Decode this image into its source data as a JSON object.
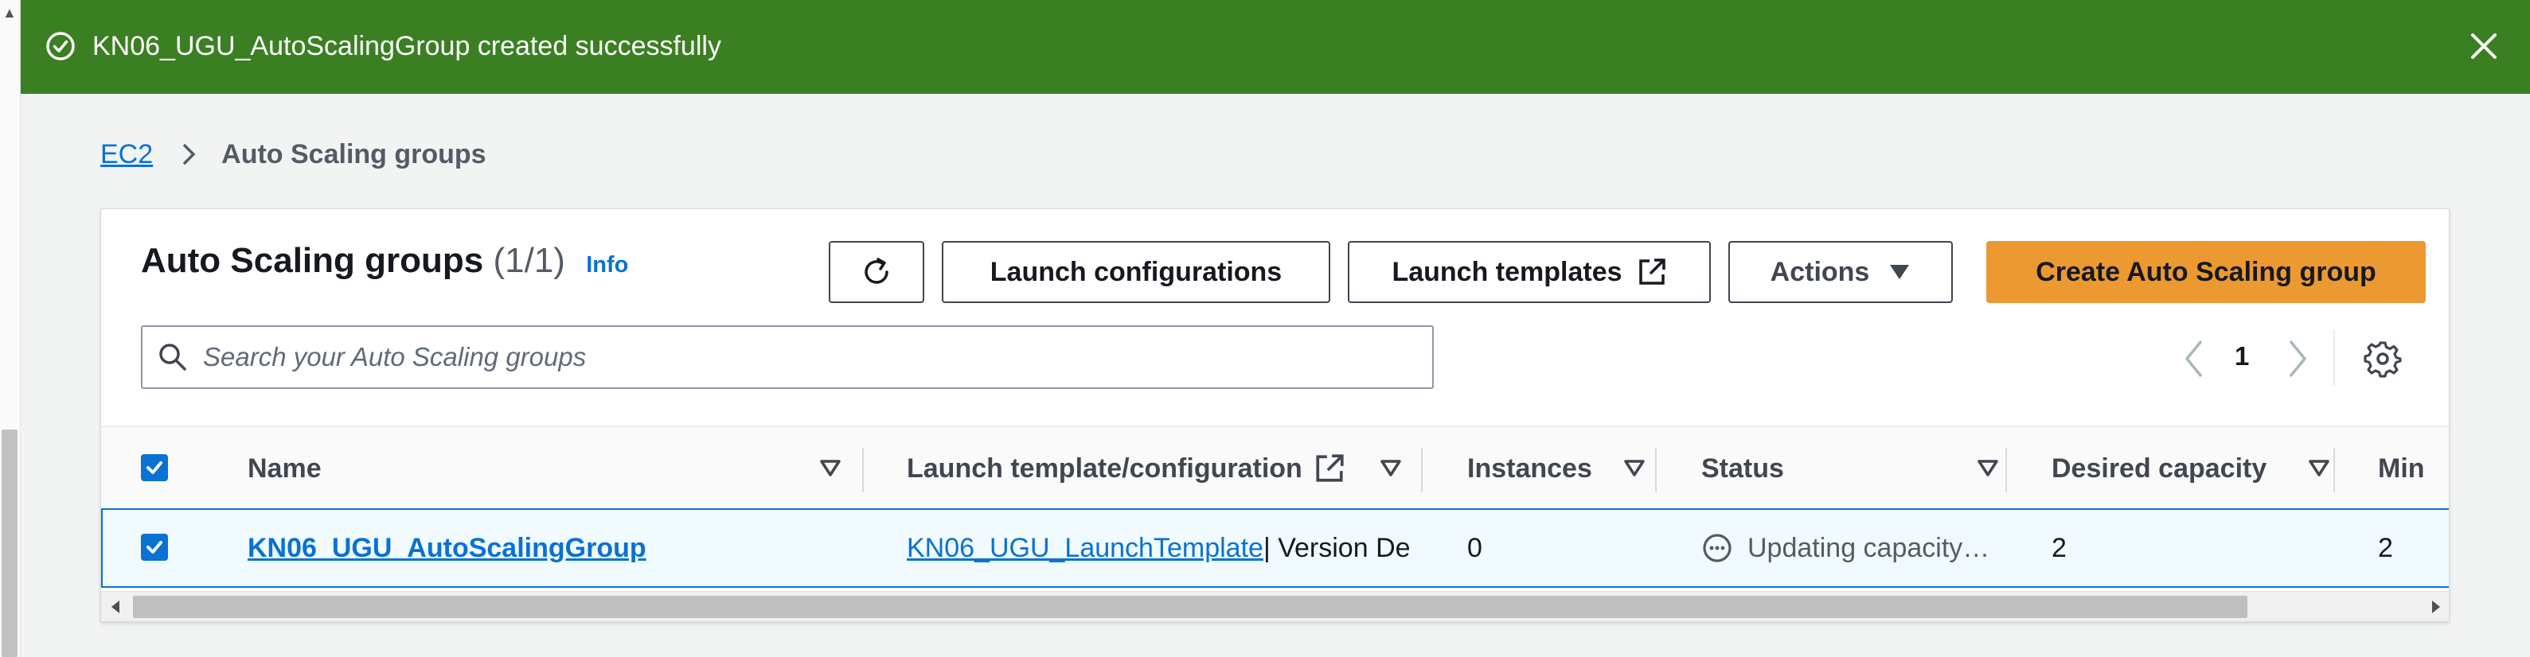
{
  "flash": {
    "message": "KN06_UGU_AutoScalingGroup created successfully",
    "status_color": "#3b7f23"
  },
  "breadcrumb": {
    "parent": "EC2",
    "current": "Auto Scaling groups"
  },
  "panel": {
    "title": "Auto Scaling groups",
    "count": "(1/1)",
    "info": "Info"
  },
  "toolbar": {
    "launch_configurations": "Launch configurations",
    "launch_templates": "Launch templates",
    "actions": "Actions",
    "create": "Create Auto Scaling group",
    "create_color": "#ec9932"
  },
  "search": {
    "placeholder": "Search your Auto Scaling groups"
  },
  "pagination": {
    "current_page": "1"
  },
  "table": {
    "columns": [
      "Name",
      "Launch template/configuration",
      "Instances",
      "Status",
      "Desired capacity",
      "Min"
    ],
    "rows": [
      {
        "name": "KN06_UGU_AutoScalingGroup",
        "launch_template": "KN06_UGU_LaunchTemplate",
        "launch_template_suffix": " | Version De",
        "instances": "0",
        "status": "Updating capacity…",
        "desired_capacity": "2",
        "min": "2"
      }
    ]
  },
  "icons": {
    "flash_status": "check-circle-icon",
    "flash_close": "close-icon",
    "breadcrumb_separator": "chevron-right-icon",
    "refresh": "refresh-icon",
    "external": "external-link-icon",
    "dropdown": "caret-down-icon",
    "search": "search-icon",
    "settings": "gear-icon",
    "status": "pending-icon"
  }
}
